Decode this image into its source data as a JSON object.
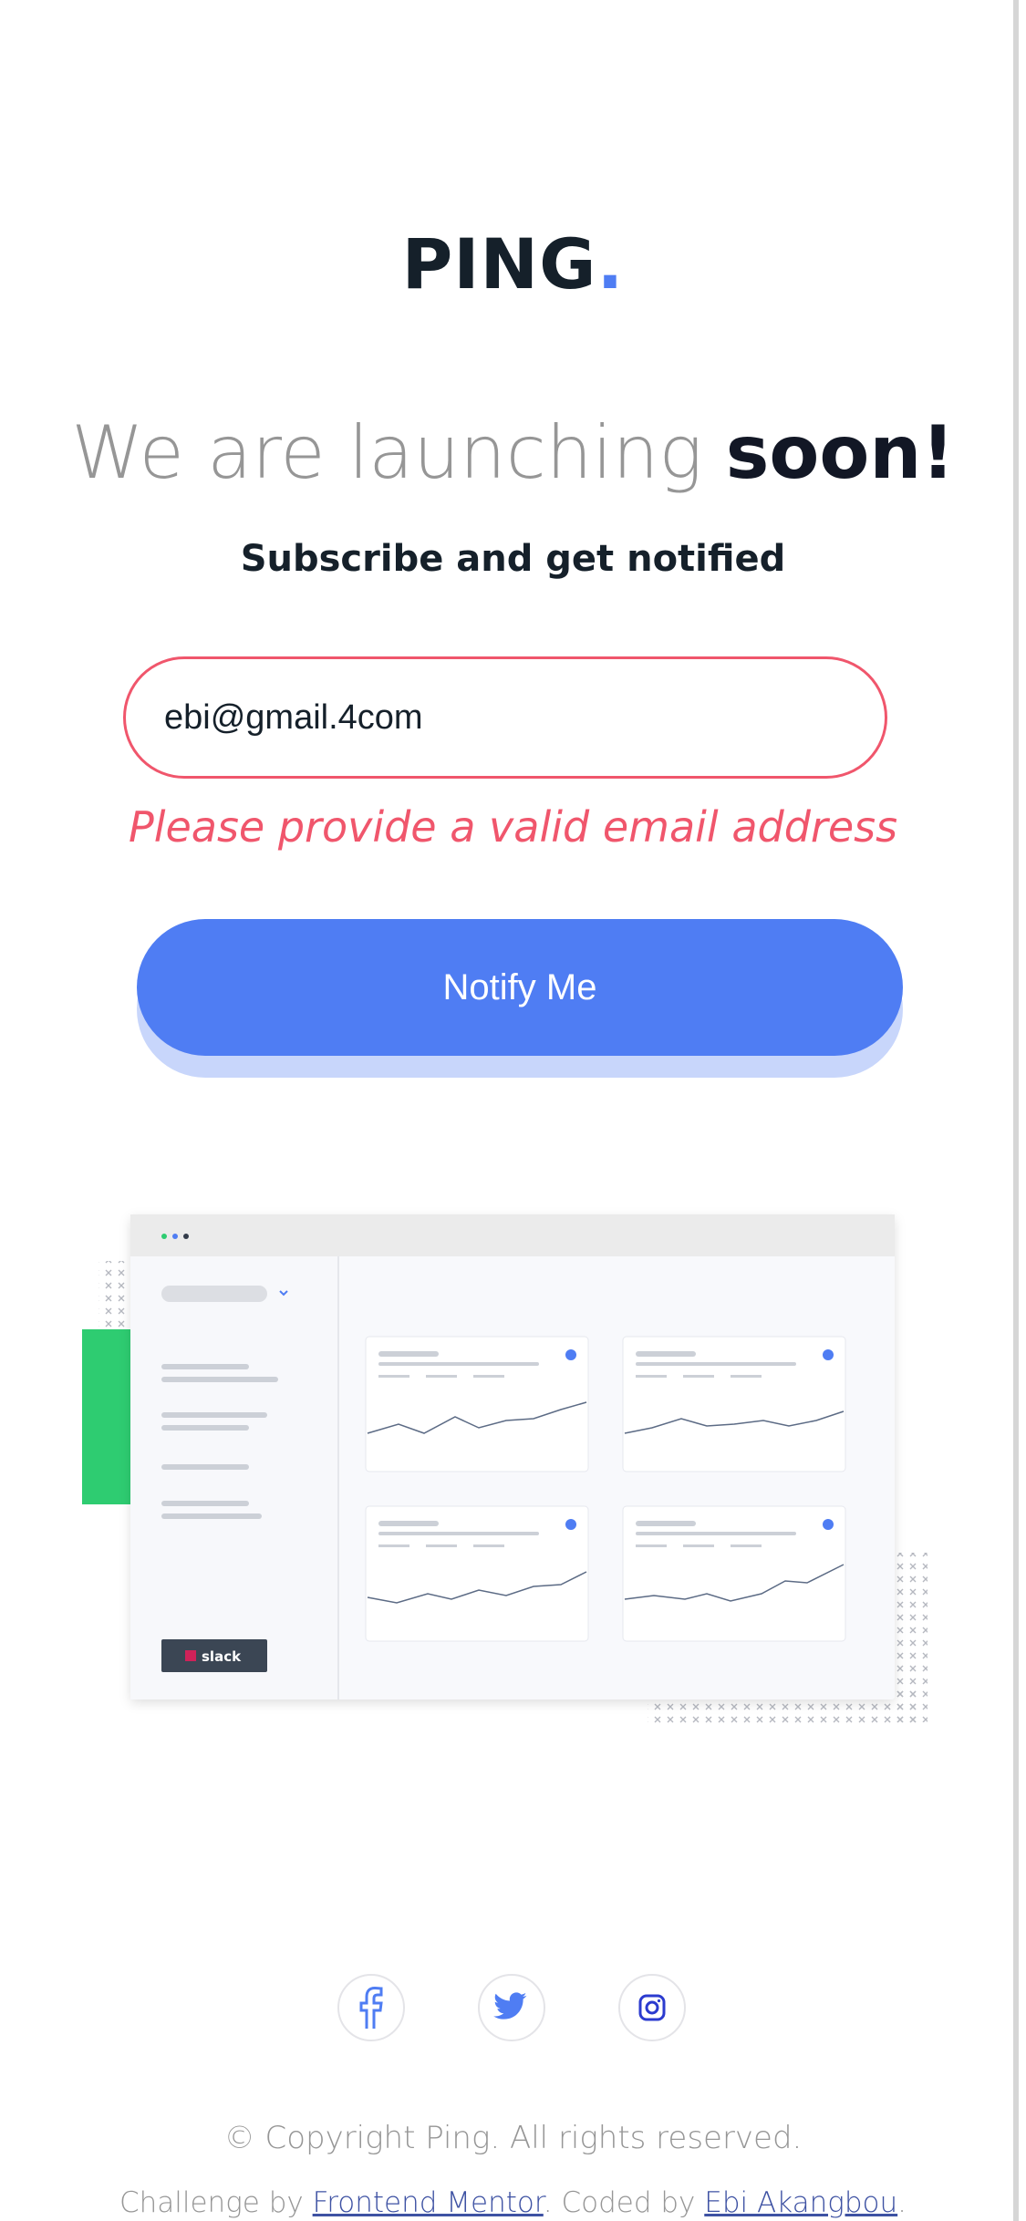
{
  "logo": {
    "text": "PING",
    "dot": ".",
    "dot_color": "#4f7df3"
  },
  "headline": {
    "light": "We are launching",
    "bold": "soon!"
  },
  "subhead": "Subscribe and get notified",
  "form": {
    "email_value": "ebi@gmail.4com",
    "error_message": "Please provide a valid email address",
    "submit_label": "Notify Me",
    "error_color": "#f0566c",
    "button_color": "#4f7df3"
  },
  "illustration": {
    "sidebar_brand": "slack",
    "accent_green": "#2ecc71"
  },
  "social": [
    {
      "icon": "facebook-icon"
    },
    {
      "icon": "twitter-icon"
    },
    {
      "icon": "instagram-icon"
    }
  ],
  "footer": {
    "copyright": "© Copyright Ping. All rights reserved.",
    "challenge_prefix": "Challenge by",
    "challenge_link": "Frontend Mentor",
    "coded_prefix": ". Coded by",
    "coded_link": "Ebi Akangbou",
    "suffix": "."
  }
}
